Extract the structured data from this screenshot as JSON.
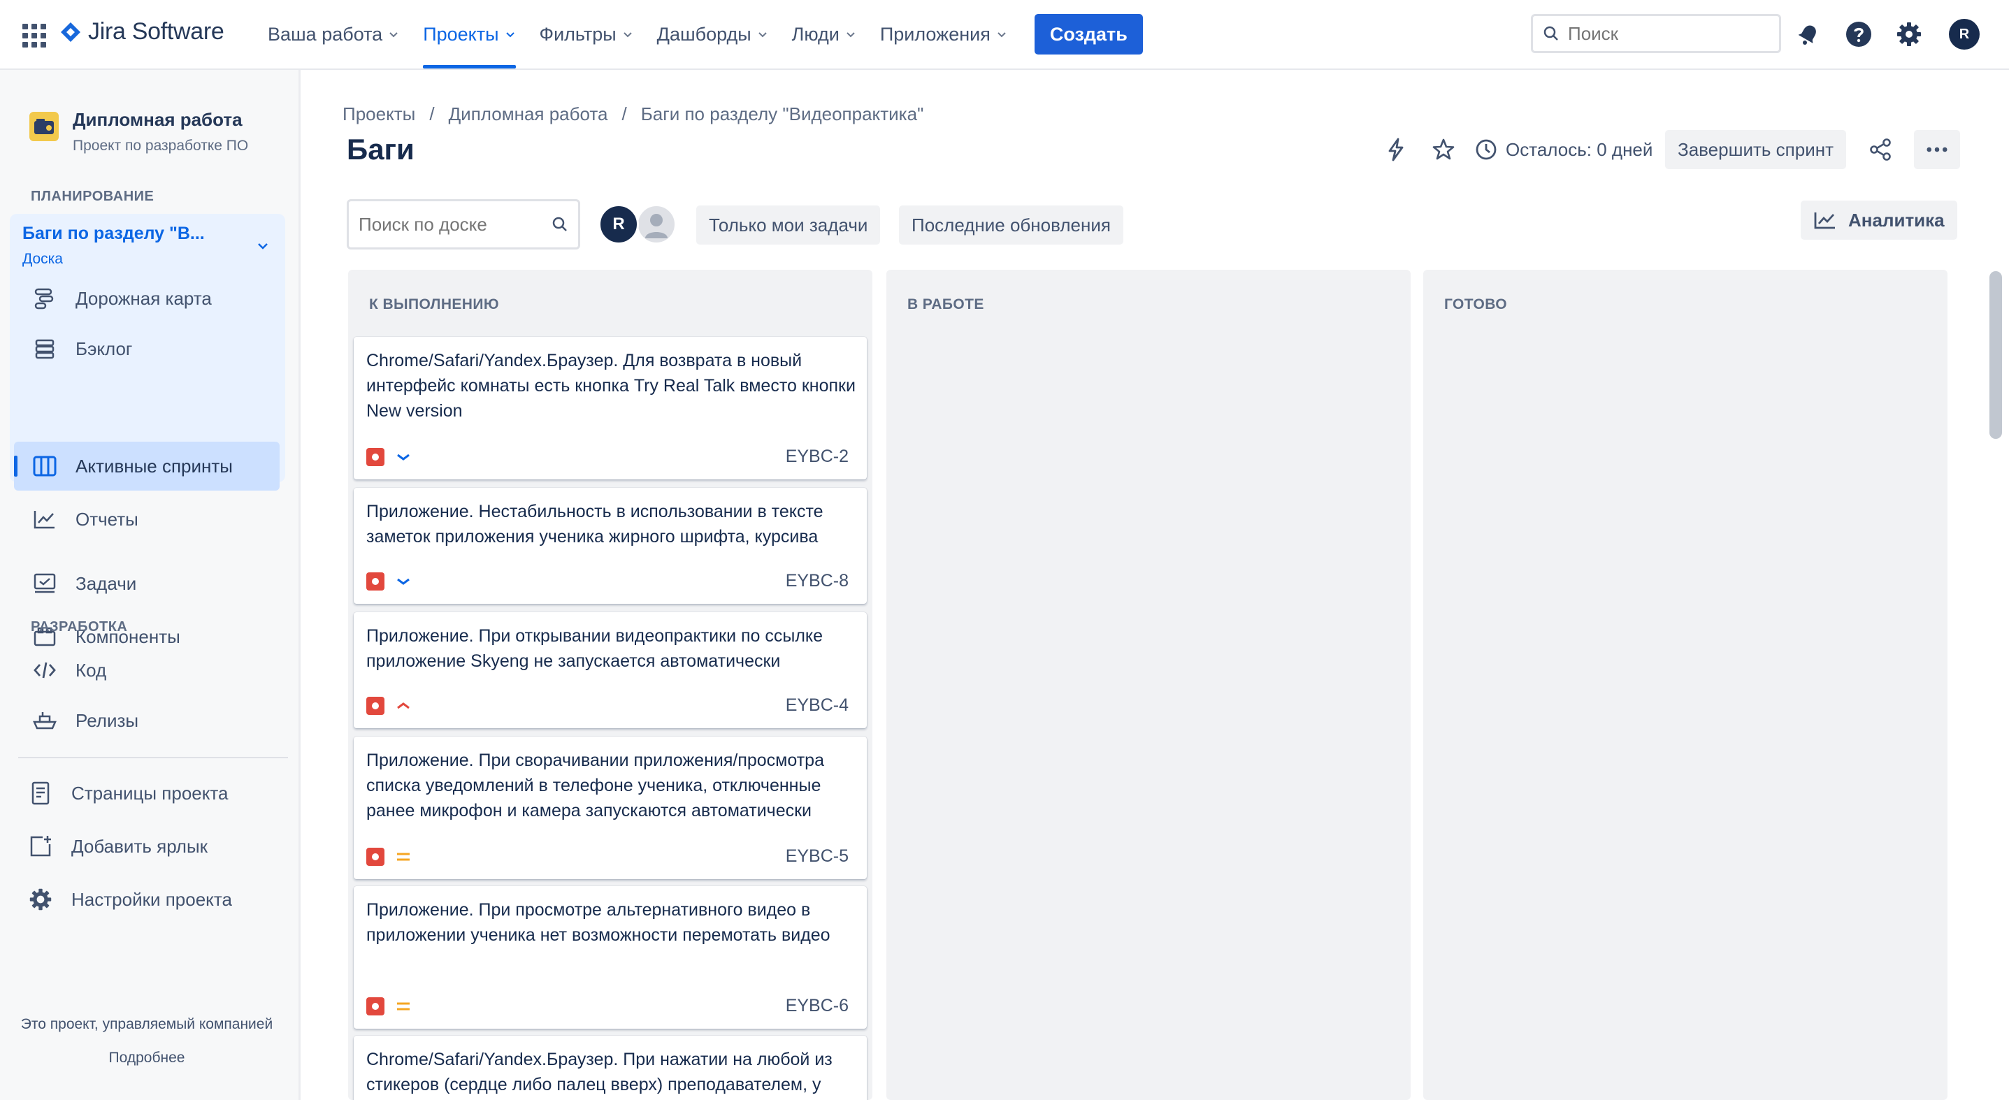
{
  "topnav": {
    "logo": "Jira Software",
    "items": [
      {
        "label": "Ваша работа",
        "active": false
      },
      {
        "label": "Проекты",
        "active": true
      },
      {
        "label": "Фильтры",
        "active": false
      },
      {
        "label": "Дашборды",
        "active": false
      },
      {
        "label": "Люди",
        "active": false
      },
      {
        "label": "Приложения",
        "active": false
      }
    ],
    "create": "Создать",
    "search_placeholder": "Поиск",
    "avatar": "R"
  },
  "sidebar": {
    "project_name": "Дипломная работа",
    "project_sub": "Проект по разработке ПО",
    "planning_label": "ПЛАНИРОВАНИЕ",
    "board_title": "Баги по разделу \"В...",
    "board_sub": "Доска",
    "planning_items": [
      {
        "label": "Дорожная карта",
        "icon": "roadmap-icon"
      },
      {
        "label": "Бэклог",
        "icon": "backlog-icon"
      },
      {
        "label": "Активные спринты",
        "icon": "board-icon"
      },
      {
        "label": "Отчеты",
        "icon": "reports-icon"
      }
    ],
    "misc_items": [
      {
        "label": "Задачи",
        "icon": "issues-icon"
      },
      {
        "label": "Компоненты",
        "icon": "components-icon"
      }
    ],
    "dev_label": "РАЗРАБОТКА",
    "dev_items": [
      {
        "label": "Код",
        "icon": "code-icon"
      },
      {
        "label": "Релизы",
        "icon": "releases-icon"
      }
    ],
    "bottom_items": [
      {
        "label": "Страницы проекта",
        "icon": "pages-icon"
      },
      {
        "label": "Добавить ярлык",
        "icon": "add-shortcut-icon"
      },
      {
        "label": "Настройки проекта",
        "icon": "settings-icon"
      }
    ],
    "footer_text": "Это проект, управляемый компанией",
    "footer_link": "Подробнее"
  },
  "main": {
    "breadcrumb": [
      "Проекты",
      "Дипломная работа",
      "Баги по разделу \"Видеопрактика\""
    ],
    "title": "Баги",
    "time_left": "Осталось: 0 дней",
    "complete_sprint": "Завершить спринт",
    "board_search_placeholder": "Поиск по доске",
    "avatar": "R",
    "only_my": "Только мои задачи",
    "recent": "Последние обновления",
    "analytics": "Аналитика"
  },
  "columns": [
    {
      "title": "К ВЫПОЛНЕНИЮ",
      "cards": [
        {
          "title": "Chrome/Safari/Yandex.Браузер. Для возврата в новый интерфейс комнаты есть кнопка Try Real Talk вместо кнопки New version",
          "key": "EYBC-2",
          "priority": "low"
        },
        {
          "title": "Приложение. Нестабильность в использовании в тексте заметок приложения ученика жирного шрифта, курсива",
          "key": "EYBC-8",
          "priority": "low"
        },
        {
          "title": "Приложение. При открывании видеопрактики по ссылке приложение Skyeng не запускается автоматически",
          "key": "EYBC-4",
          "priority": "high"
        },
        {
          "title": "Приложение. При сворачивании приложения/просмотра списка уведомлений в телефоне ученика, отключенные ранее микрофон и камера запускаются автоматически",
          "key": "EYBC-5",
          "priority": "medium"
        },
        {
          "title": "Приложение. При просмотре альтернативного видео в приложении ученика нет возможности перемотать видео",
          "key": "EYBC-6",
          "priority": "medium"
        },
        {
          "title": "Chrome/Safari/Yandex.Браузер. При нажатии на любой из стикеров (сердце либо палец вверх) преподавателем, у",
          "key": "",
          "priority": ""
        }
      ]
    },
    {
      "title": "В РАБОТЕ",
      "cards": []
    },
    {
      "title": "ГОТОВО",
      "cards": []
    }
  ],
  "colors": {
    "accent": "#0c66e4",
    "create_button": "#1d60d8",
    "bug": "#e2483d",
    "priority_low": "#0c66e4",
    "priority_high": "#e2483d",
    "priority_medium": "#f5a623"
  }
}
